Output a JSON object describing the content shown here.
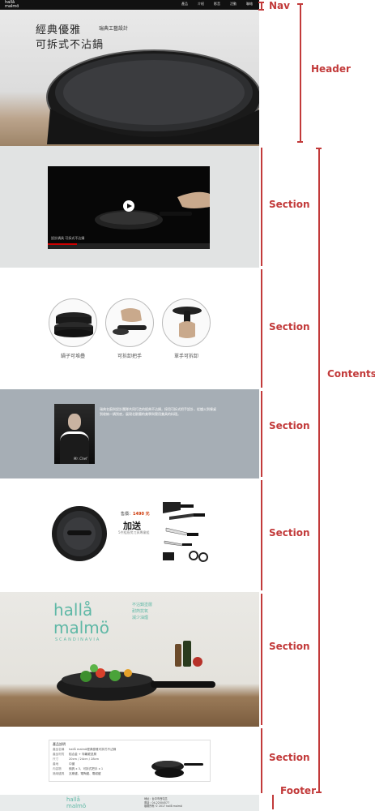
{
  "nav": {
    "logo_top": "hallå",
    "logo_bottom": "malmö",
    "menu": [
      "產品",
      "介紹",
      "影音",
      "活動",
      "聯絡"
    ]
  },
  "hero": {
    "title_line1": "經典優雅",
    "title_sub": "瑞典工藝設計",
    "title_line2": "可拆式不沾鍋"
  },
  "video": {
    "caption": "設計鍋具 可拆式不沾鍋"
  },
  "features": {
    "items": [
      {
        "label": "鍋子可堆疊",
        "icon": "stacked-pans-icon"
      },
      {
        "label": "可拆卸把手",
        "icon": "detachable-handle-icon"
      },
      {
        "label": "單手可拆卸",
        "icon": "one-hand-release-icon"
      }
    ]
  },
  "chef": {
    "signature": "Mr. Chef",
    "bio": "瑞典名廚與設計團隊共同打造的經典不沾鍋，採用可拆式把手設計，從爐火到餐桌到收納一鍋到底，展現北歐簡約美學與實用兼具的料理。"
  },
  "offer": {
    "price_label": "售價：",
    "price_value": "1490 元",
    "gift_title": "加送",
    "gift_sub": "5件組廚房刀具專業組"
  },
  "brand": {
    "logo_top": "hallå",
    "logo_bottom": "malmö",
    "tagline": "SCANDINAVIA",
    "tags": [
      "不沾鍋塗層",
      "耐熱抗氧",
      "減少油煙"
    ]
  },
  "spec": {
    "title": "產品說明",
    "rows": [
      {
        "k": "產品名稱",
        "v": "hallå malmö經典優雅可拆式不沾鍋"
      },
      {
        "k": "產品材質",
        "v": "鋁合金 + 特氟龍塗層"
      },
      {
        "k": "尺寸",
        "v": "20cm / 24cm / 28cm"
      },
      {
        "k": "產地",
        "v": "中國"
      },
      {
        "k": "內容物",
        "v": "鍋具 x 3、可拆式把手 x 1"
      },
      {
        "k": "適用爐具",
        "v": "瓦斯爐、電陶爐、電磁爐"
      }
    ]
  },
  "footer": {
    "logo_top": "hallå",
    "logo_bottom": "malmö",
    "info": [
      "地址：台中市西屯區",
      "電話：04-22004577",
      "版權所有 © 2017 hallå malmö"
    ]
  },
  "annotations": {
    "nav": "Nav",
    "header": "Header",
    "section": "Section",
    "contents": "Contents",
    "footer": "Footer"
  },
  "colors": {
    "annotation": "#c23a3a",
    "brand_teal": "#5fb8a6",
    "chef_band": "#a6aeb5",
    "video_band": "#e1e3e3"
  }
}
